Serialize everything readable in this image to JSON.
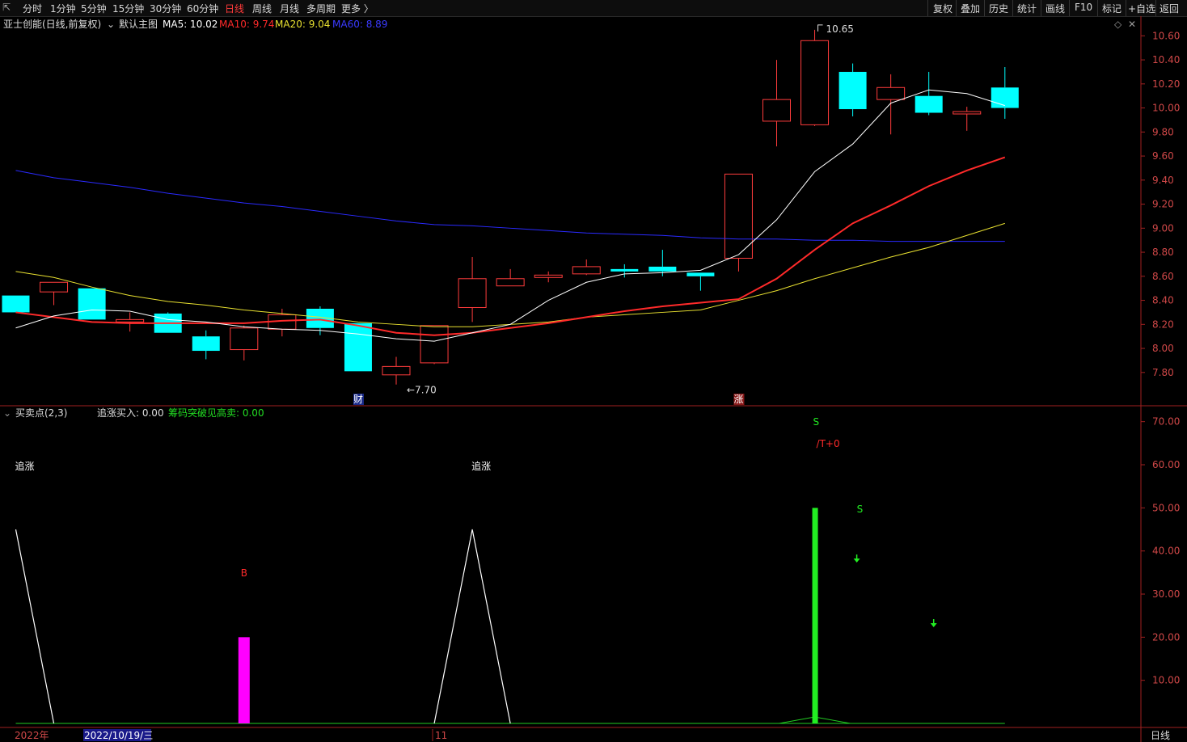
{
  "toolbar": {
    "left_items": [
      "分时",
      "1分钟",
      "5分钟",
      "15分钟",
      "30分钟",
      "60分钟",
      "日线",
      "周线",
      "月线",
      "多周期",
      "更多 〉"
    ],
    "active": "日线",
    "right_items": [
      "复权",
      "叠加",
      "历史",
      "统计",
      "画线",
      "F10",
      "标记",
      "+自选",
      "返回"
    ]
  },
  "main_header": {
    "stock": "亚士创能(日线,前复权)",
    "chart_name": "默认主图",
    "ma5_label": "MA5: 10.02",
    "ma10_label": "MA10: 9.74",
    "ma20_label": "MA20: 9.04",
    "ma60_label": "MA60: 8.89",
    "colors": {
      "ma5": "#ffffff",
      "ma10": "#ff2a2a",
      "ma20": "#e8e030",
      "ma60": "#2a2aff"
    }
  },
  "indicator_header": {
    "name": "买卖点(2,3)",
    "field1": "追涨买入: 0.00",
    "field2": "筹码突破见高卖: 0.00"
  },
  "bottom_bar": {
    "year": "2022年",
    "date": "2022/10/19/三",
    "month": "11",
    "period": "日线"
  },
  "chart_data": [
    {
      "type": "candlestick",
      "ylim": [
        7.55,
        10.75
      ],
      "y_ticks": [
        "10.60",
        "10.40",
        "10.20",
        "10.00",
        "9.80",
        "9.60",
        "9.40",
        "9.20",
        "9.00",
        "8.80",
        "8.60",
        "8.40",
        "8.20",
        "8.00",
        "7.80"
      ],
      "candles": [
        {
          "o": 8.44,
          "h": 8.44,
          "l": 8.3,
          "c": 8.3
        },
        {
          "o": 8.47,
          "h": 8.55,
          "l": 8.36,
          "c": 8.55
        },
        {
          "o": 8.5,
          "h": 8.5,
          "l": 8.24,
          "c": 8.24
        },
        {
          "o": 8.22,
          "h": 8.3,
          "l": 8.14,
          "c": 8.24
        },
        {
          "o": 8.29,
          "h": 8.3,
          "l": 8.13,
          "c": 8.13
        },
        {
          "o": 8.1,
          "h": 8.15,
          "l": 7.91,
          "c": 7.98
        },
        {
          "o": 7.99,
          "h": 8.19,
          "l": 7.9,
          "c": 8.17
        },
        {
          "o": 8.16,
          "h": 8.33,
          "l": 8.1,
          "c": 8.28
        },
        {
          "o": 8.33,
          "h": 8.35,
          "l": 8.11,
          "c": 8.17
        },
        {
          "o": 8.21,
          "h": 8.21,
          "l": 7.81,
          "c": 7.81
        },
        {
          "o": 7.78,
          "h": 7.93,
          "l": 7.7,
          "c": 7.85
        },
        {
          "o": 7.88,
          "h": 8.19,
          "l": 7.87,
          "c": 8.19
        },
        {
          "o": 8.34,
          "h": 8.76,
          "l": 8.22,
          "c": 8.58
        },
        {
          "o": 8.52,
          "h": 8.66,
          "l": 8.52,
          "c": 8.58
        },
        {
          "o": 8.59,
          "h": 8.64,
          "l": 8.55,
          "c": 8.61
        },
        {
          "o": 8.62,
          "h": 8.74,
          "l": 8.61,
          "c": 8.68
        },
        {
          "o": 8.66,
          "h": 8.7,
          "l": 8.59,
          "c": 8.64
        },
        {
          "o": 8.68,
          "h": 8.82,
          "l": 8.6,
          "c": 8.64
        },
        {
          "o": 8.63,
          "h": 8.63,
          "l": 8.48,
          "c": 8.6
        },
        {
          "o": 8.75,
          "h": 9.45,
          "l": 8.64,
          "c": 9.45
        },
        {
          "o": 9.89,
          "h": 10.4,
          "l": 9.68,
          "c": 10.07
        },
        {
          "o": 9.86,
          "h": 10.65,
          "l": 9.85,
          "c": 10.56
        },
        {
          "o": 10.3,
          "h": 10.37,
          "l": 9.93,
          "c": 9.99
        },
        {
          "o": 10.07,
          "h": 10.28,
          "l": 9.78,
          "c": 10.17
        },
        {
          "o": 10.1,
          "h": 10.3,
          "l": 9.94,
          "c": 9.96
        },
        {
          "o": 9.95,
          "h": 10.01,
          "l": 9.81,
          "c": 9.97
        },
        {
          "o": 10.17,
          "h": 10.34,
          "l": 9.91,
          "c": 10.0
        }
      ],
      "ma5": [
        8.17,
        8.27,
        8.32,
        8.31,
        8.24,
        8.22,
        8.18,
        8.16,
        8.15,
        8.12,
        8.08,
        8.06,
        8.13,
        8.2,
        8.4,
        8.55,
        8.62,
        8.63,
        8.65,
        8.78,
        9.07,
        9.47,
        9.7,
        10.04,
        10.15,
        10.12,
        10.02
      ],
      "ma10": [
        8.3,
        8.26,
        8.22,
        8.21,
        8.21,
        8.21,
        8.21,
        8.23,
        8.24,
        8.19,
        8.13,
        8.11,
        8.13,
        8.17,
        8.21,
        8.26,
        8.31,
        8.35,
        8.38,
        8.41,
        8.58,
        8.82,
        9.04,
        9.19,
        9.35,
        9.48,
        9.59,
        9.74
      ],
      "ma20": [
        8.64,
        8.59,
        8.51,
        8.44,
        8.39,
        8.36,
        8.32,
        8.29,
        8.26,
        8.22,
        8.2,
        8.18,
        8.18,
        8.2,
        8.22,
        8.26,
        8.28,
        8.3,
        8.32,
        8.4,
        8.48,
        8.58,
        8.67,
        8.76,
        8.84,
        8.94,
        9.04
      ],
      "ma60": [
        9.48,
        9.42,
        9.38,
        9.34,
        9.29,
        9.25,
        9.21,
        9.18,
        9.14,
        9.1,
        9.06,
        9.03,
        9.02,
        9.0,
        8.98,
        8.96,
        8.95,
        8.94,
        8.92,
        8.91,
        8.91,
        8.9,
        8.9,
        8.89,
        8.89,
        8.89,
        8.89
      ],
      "annotations": [
        {
          "label": "10.65",
          "at_candle": 21,
          "value": 10.65
        },
        {
          "label": "7.70",
          "at_candle": 10,
          "value": 7.7
        },
        {
          "label": "财",
          "at_candle": 9
        },
        {
          "label": "涨",
          "at_candle": 19
        }
      ]
    },
    {
      "type": "bar",
      "ylim": [
        0,
        72
      ],
      "y_ticks": [
        "70.00",
        "60.00",
        "50.00",
        "40.00",
        "30.00",
        "20.00",
        "10.00"
      ],
      "line_series": [
        45,
        0,
        0,
        0,
        0,
        0,
        0,
        0,
        0,
        0,
        0,
        0,
        45,
        0,
        0,
        0,
        0,
        0,
        0,
        0,
        0,
        0,
        0,
        0,
        0,
        0,
        0
      ],
      "magenta_bar": {
        "at_candle": 6,
        "value": 20
      },
      "green_bar": {
        "at_candle": 21,
        "value": 50
      },
      "texts": [
        {
          "label": "追涨",
          "at_candle": 0
        },
        {
          "label": "追涨",
          "at_candle": 12
        },
        {
          "label": "B",
          "at_candle": 6
        },
        {
          "label": "S",
          "at_candle": 22
        },
        {
          "label": "S",
          "at_candle": 21
        },
        {
          "label": "/T+0",
          "at_candle": 21
        }
      ]
    }
  ]
}
